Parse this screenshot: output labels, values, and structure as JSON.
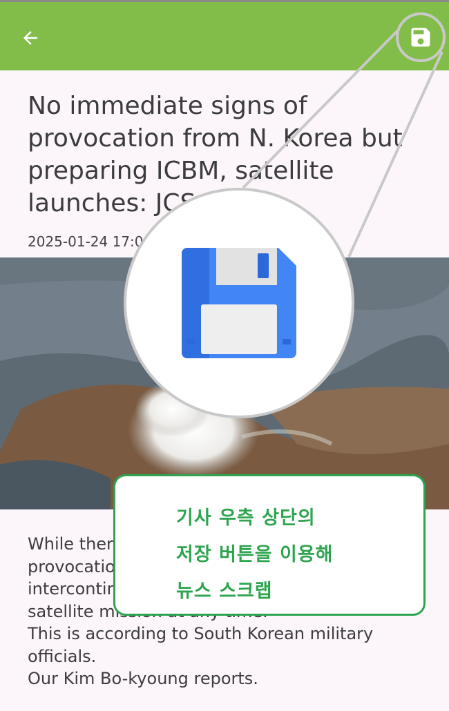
{
  "header": {
    "back_icon": "arrow-left-icon",
    "save_icon": "save-disk-icon"
  },
  "article": {
    "title": "No immediate signs of provocation from N. Korea but preparing ICBM, satellite launches: JCS",
    "date": "2025-01-24 17:0",
    "body": [
      "While ther",
      "provocatio",
      "intercontir",
      "satellite mission at any time.",
      "This is according to South Korean military officials.",
      "Our Kim Bo-kyoung  reports."
    ]
  },
  "callout": {
    "lines": [
      "기사 우측 상단의",
      "저장 버튼을 이용해",
      "뉴스 스크랩"
    ]
  },
  "colors": {
    "app_bar": "#82bd4a",
    "background": "#fcf6fb",
    "callout_accent": "#2ea44f",
    "disk_blue": "#4285f4"
  }
}
